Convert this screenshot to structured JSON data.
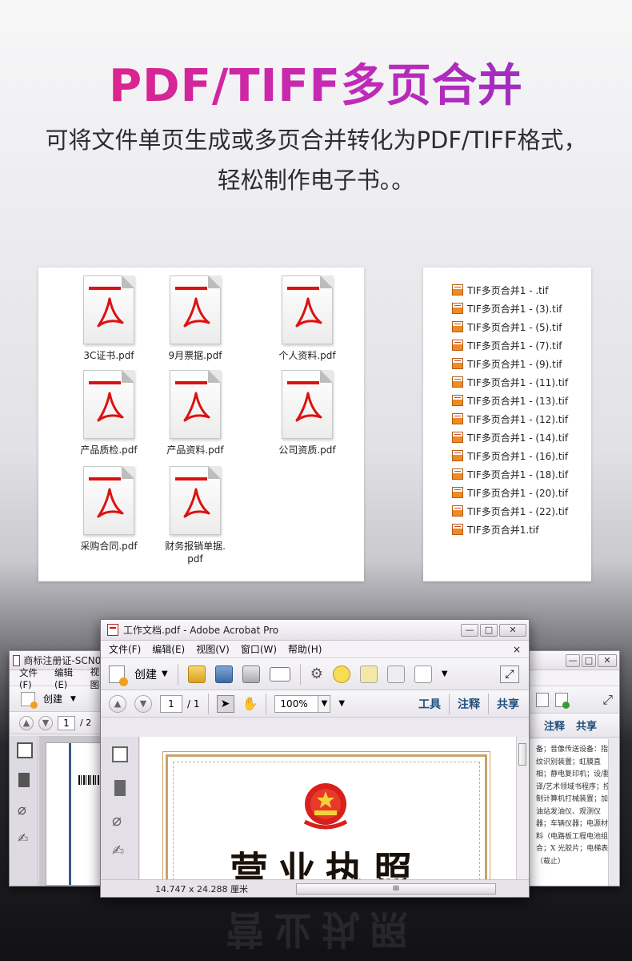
{
  "hero": {
    "title": "PDF/TIFF多页合并",
    "subtitle_line1": "可将文件单页生成或多页合并转化为PDF/TIFF格式，",
    "subtitle_line2": "轻松制作电子书。。"
  },
  "pdf_files": [
    {
      "name": "3C证书.pdf"
    },
    {
      "name": "9月票据.pdf"
    },
    {
      "name": "个人资料.pdf"
    },
    {
      "name": "产品质检.pdf"
    },
    {
      "name": "产品资料.pdf"
    },
    {
      "name": "公司资质.pdf"
    },
    {
      "name": "采购合同.pdf"
    },
    {
      "name_line1": "财务报销单据.",
      "name_line2": "pdf"
    }
  ],
  "tif_files": [
    "TIF多页合并1 - .tif",
    "TIF多页合并1 - (3).tif",
    "TIF多页合并1 - (5).tif",
    "TIF多页合并1 - (7).tif",
    "TIF多页合并1 - (9).tif",
    "TIF多页合并1 - (11).tif",
    "TIF多页合并1 - (13).tif",
    "TIF多页合并1 - (12).tif",
    "TIF多页合并1 - (14).tif",
    "TIF多页合并1 - (16).tif",
    "TIF多页合并1 - (18).tif",
    "TIF多页合并1 - (20).tif",
    "TIF多页合并1 - (22).tif",
    "TIF多页合并1.tif"
  ],
  "left_window": {
    "title": "商标注册证-SCN00",
    "menu": [
      "文件(F)",
      "编辑(E)",
      "视图"
    ],
    "create_label": "创建",
    "page_value": "1",
    "page_total": "/ 2"
  },
  "right_window": {
    "links": [
      "注释",
      "共享"
    ],
    "body_text": "备；音像传送设备：指纹识别装置；虹膜直相；静电复印机；设/翻译/艺术领域书程序；控制计算机打械装置；加油站发油仪、观测仪器；车辆仪器；电源材料（电路板工程电池组合；X 光胶片；电梯表（载止）"
  },
  "main_window": {
    "title": "工作文档.pdf - Adobe Acrobat Pro",
    "menu": [
      "文件(F)",
      "编辑(E)",
      "视图(V)",
      "窗口(W)",
      "帮助(H)"
    ],
    "create_label": "创建",
    "page_value": "1",
    "page_total": "/ 1",
    "zoom_value": "100%",
    "links": [
      "工具",
      "注释",
      "共享"
    ],
    "document_title": "营业执照",
    "status_dims": "14.747 x 24.288 厘米",
    "scroll_mark": "III"
  },
  "window_buttons": {
    "minimize": "—",
    "restore": "□",
    "close": "✕"
  },
  "colors": {
    "title_gradient": [
      "#e8217a",
      "#8b2fc4"
    ],
    "pdf_red": "#dd1111",
    "tif_orange": "#f08a21",
    "link_blue": "#20507e"
  }
}
